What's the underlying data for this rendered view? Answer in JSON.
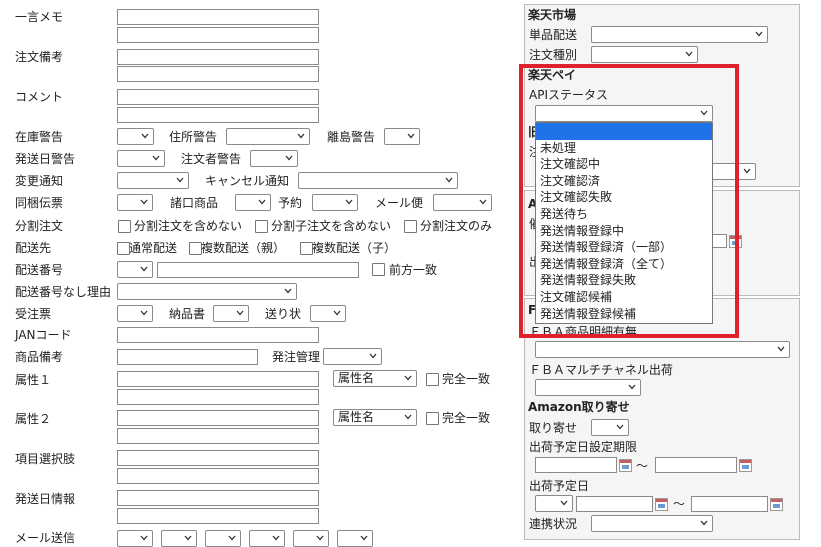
{
  "left": {
    "ichigon_memo": "一言メモ",
    "chumon_biko": "注文備考",
    "comment": "コメント",
    "zaiko_keikoku": "在庫警告",
    "jusho_keikoku": "住所警告",
    "rito_keikoku": "離島警告",
    "hasso_keikoku": "発送日警告",
    "chumonsha_keikoku": "注文者警告",
    "henko_tsuchi": "変更通知",
    "cancel_tsuchi": "キャンセル通知",
    "dokon_denpyo": "同梱伝票",
    "shoguchi": "諸口商品",
    "yoyaku": "予約",
    "mail_bin": "メール便",
    "bunkatsu": "分割注文",
    "opt_bunkatsu_fukumanai": "分割注文を含めない",
    "opt_bunkatsu_ko_fukumanai": "分割子注文を含めない",
    "opt_bunkatsu_nomi": "分割注文のみ",
    "haisosaki": "配送先",
    "opt_tsujo": "通常配送",
    "opt_fukusu_oya": "複数配送（親）",
    "opt_fukusu_ko": "複数配送（子）",
    "haiso_bango": "配送番号",
    "zenpo_icchi": "前方一致",
    "haiso_nashi_riyu": "配送番号なし理由",
    "juchuhyo": "受注票",
    "nohinsho": "納品書",
    "okurijo": "送り状",
    "jan": "JANコード",
    "shohin_biko": "商品備考",
    "hatchu_kanri": "発注管理",
    "zokusei1": "属性１",
    "zokusei2": "属性２",
    "zokusei_mei": "属性名",
    "kanzen_icchi": "完全一致",
    "komoku_sentakushi": "項目選択肢",
    "hassobi_joho": "発送日情報",
    "mail_soshin": "メール送信"
  },
  "rakuten": {
    "title": "楽天市場",
    "tanpin_haiso": "単品配送",
    "chumon_shubetsu": "注文種別",
    "pay_title": "楽天ペイ",
    "api_status": "APIステータス",
    "options": [
      "",
      "未処理",
      "注文確認中",
      "注文確認済",
      "注文確認失敗",
      "発送待ち",
      "発送情報登録中",
      "発送情報登録済（一部）",
      "発送情報登録済（全て）",
      "発送情報登録失敗",
      "注文確認候補",
      "発送情報登録候補"
    ],
    "peek_kyu": "旧",
    "peek_chu": "注",
    "peek_a": "A",
    "peek_ki": "催",
    "peek_de": "出",
    "peek_f": "F"
  },
  "amazon": {
    "fba_meisai": "ＦＢＡ商品明細有無",
    "fba_multi": "ＦＢＡマルチチャネル出荷",
    "toriyose_title": "Amazon取り寄せ",
    "toriyose": "取り寄せ",
    "kigen": "出荷予定日設定期限",
    "yoteibi": "出荷予定日",
    "renkei": "連携状況",
    "tilde": "〜"
  },
  "colors": {
    "highlight": "#1e73e8",
    "callout": "#e0202a",
    "panel": "#f5f5f5"
  }
}
